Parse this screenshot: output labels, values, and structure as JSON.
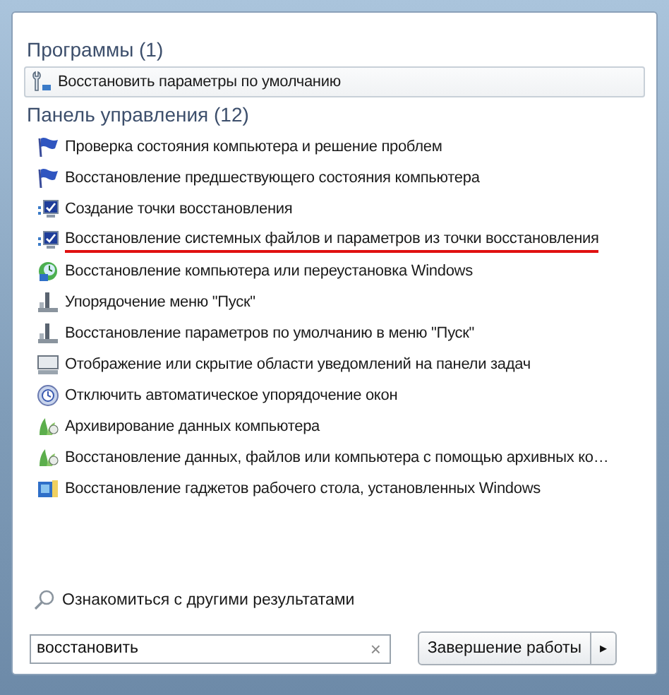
{
  "groups": [
    {
      "title": "Программы (1)",
      "items": [
        {
          "label": "Восстановить параметры по умолчанию",
          "kind": "wrench",
          "selected": true,
          "underlined": false
        }
      ]
    },
    {
      "title": "Панель управления (12)",
      "items": [
        {
          "label": "Проверка состояния компьютера и решение проблем",
          "kind": "flag",
          "selected": false,
          "underlined": false
        },
        {
          "label": "Восстановление предшествующего состояния компьютера",
          "kind": "flag",
          "selected": false,
          "underlined": false
        },
        {
          "label": "Создание точки восстановления",
          "kind": "monitor",
          "selected": false,
          "underlined": false
        },
        {
          "label": "Восстановление системных файлов и параметров из точки восстановления",
          "kind": "monitor",
          "selected": false,
          "underlined": true
        },
        {
          "label": "Восстановление компьютера или переустановка Windows",
          "kind": "restore",
          "selected": false,
          "underlined": false
        },
        {
          "label": "Упорядочение меню \"Пуск\"",
          "kind": "startmenu",
          "selected": false,
          "underlined": false
        },
        {
          "label": "Восстановление параметров по умолчанию в меню \"Пуск\"",
          "kind": "startmenu",
          "selected": false,
          "underlined": false
        },
        {
          "label": "Отображение или скрытие области уведомлений на панели задач",
          "kind": "taskbar",
          "selected": false,
          "underlined": false
        },
        {
          "label": "Отключить автоматическое упорядочение окон",
          "kind": "clock",
          "selected": false,
          "underlined": false
        },
        {
          "label": "Архивирование данных компьютера",
          "kind": "backup",
          "selected": false,
          "underlined": false
        },
        {
          "label": "Восстановление данных, файлов или компьютера с помощью архивных ко…",
          "kind": "backup",
          "selected": false,
          "underlined": false
        },
        {
          "label": "Восстановление гаджетов рабочего стола, установленных Windows",
          "kind": "gadget",
          "selected": false,
          "underlined": false
        }
      ]
    }
  ],
  "more_results": "Ознакомиться с другими результатами",
  "search": {
    "value": "восстановить",
    "clear": "×"
  },
  "shutdown": {
    "label": "Завершение работы",
    "arrow": "▸"
  }
}
